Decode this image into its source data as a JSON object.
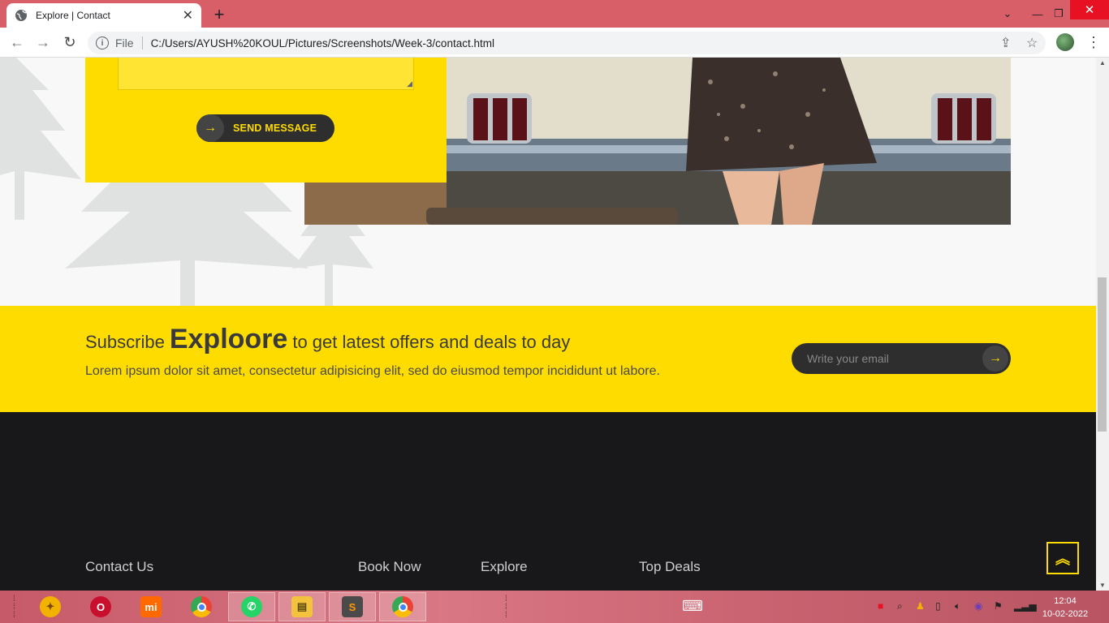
{
  "browser": {
    "tab_title": "Explore | Contact",
    "new_tab": "+",
    "scheme": "File",
    "url": "C:/Users/AYUSH%20KOUL/Pictures/Screenshots/Week-3/contact.html"
  },
  "form": {
    "send_label": "SEND MESSAGE"
  },
  "subscribe": {
    "prefix": "Subscribe",
    "brand": "Exploore",
    "suffix": "to get latest offers and deals to day",
    "description": "Lorem ipsum dolor sit amet, consectetur adipisicing elit, sed do eiusmod tempor incididunt ut labore.",
    "email_placeholder": "Write your email"
  },
  "footer": {
    "columns": [
      "Contact Us",
      "Book Now",
      "Explore",
      "Top Deals"
    ]
  },
  "taskbar": {
    "time": "12:04",
    "date": "10-02-2022"
  },
  "colors": {
    "accent": "#ffdc00",
    "dark": "#18181b",
    "tabbar": "#d85f68"
  }
}
